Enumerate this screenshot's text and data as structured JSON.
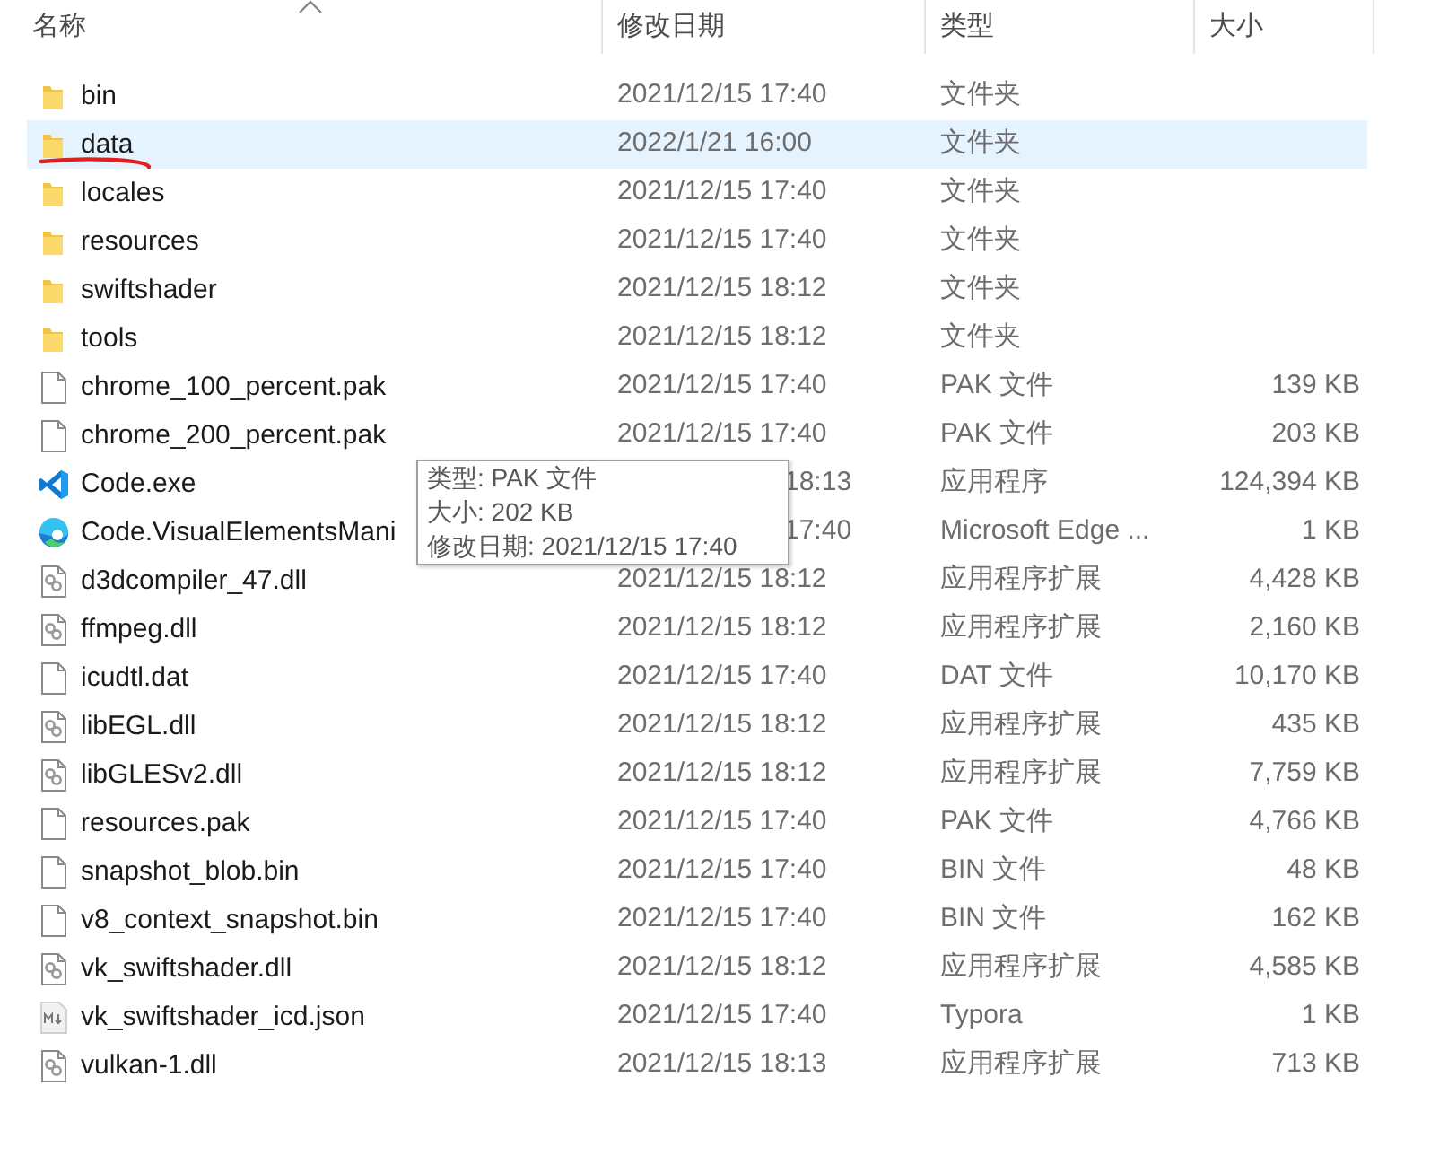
{
  "columns": [
    "名称",
    "修改日期",
    "类型",
    "大小"
  ],
  "rows": [
    {
      "kind": "folder",
      "name": "bin",
      "date": "2021/12/15 17:40",
      "type": "文件夹",
      "selected": false,
      "underlined": false
    },
    {
      "kind": "folder",
      "name": "data",
      "date": "2022/1/21 16:00",
      "type": "文件夹",
      "selected": true,
      "underlined": true
    },
    {
      "kind": "folder",
      "name": "locales",
      "date": "2021/12/15 17:40",
      "type": "文件夹",
      "selected": false,
      "underlined": false
    },
    {
      "kind": "folder",
      "name": "resources",
      "date": "2021/12/15 17:40",
      "type": "文件夹",
      "selected": false,
      "underlined": false
    },
    {
      "kind": "folder",
      "name": "swiftshader",
      "date": "2021/12/15 18:12",
      "type": "文件夹",
      "selected": false,
      "underlined": false
    },
    {
      "kind": "folder",
      "name": "tools",
      "date": "2021/12/15 18:12",
      "type": "文件夹",
      "selected": false,
      "underlined": false
    },
    {
      "kind": "file",
      "name": "chrome_100_percent.pak",
      "date": "2021/12/15 17:40",
      "type": "PAK 文件",
      "size": "139 KB",
      "selected": false,
      "underlined": false
    },
    {
      "kind": "file",
      "name": "chrome_200_percent.pak",
      "date": "2021/12/15 17:40",
      "type": "PAK 文件",
      "size": "203 KB",
      "selected": false,
      "underlined": false
    },
    {
      "kind": "vscode",
      "name": "Code.exe",
      "date": "18:13",
      "type": "应用程序",
      "size": "124,394 KB",
      "selected": false,
      "underlined": false
    },
    {
      "kind": "edge",
      "name": "Code.VisualElementsMani",
      "date": "17:40",
      "type": "Microsoft Edge ...",
      "size": "1 KB",
      "selected": false,
      "underlined": false
    },
    {
      "kind": "dll",
      "name": "d3dcompiler_47.dll",
      "date": "2021/12/15 18:12",
      "type": "应用程序扩展",
      "size": "4,428 KB",
      "selected": false,
      "underlined": false
    },
    {
      "kind": "dll",
      "name": "ffmpeg.dll",
      "date": "2021/12/15 18:12",
      "type": "应用程序扩展",
      "size": "2,160 KB",
      "selected": false,
      "underlined": false
    },
    {
      "kind": "file",
      "name": "icudtl.dat",
      "date": "2021/12/15 17:40",
      "type": "DAT 文件",
      "size": "10,170 KB",
      "selected": false,
      "underlined": false
    },
    {
      "kind": "dll",
      "name": "libEGL.dll",
      "date": "2021/12/15 18:12",
      "type": "应用程序扩展",
      "size": "435 KB",
      "selected": false,
      "underlined": false
    },
    {
      "kind": "dll",
      "name": "libGLESv2.dll",
      "date": "2021/12/15 18:12",
      "type": "应用程序扩展",
      "size": "7,759 KB",
      "selected": false,
      "underlined": false
    },
    {
      "kind": "file",
      "name": "resources.pak",
      "date": "2021/12/15 17:40",
      "type": "PAK 文件",
      "size": "4,766 KB",
      "selected": false,
      "underlined": false
    },
    {
      "kind": "file",
      "name": "snapshot_blob.bin",
      "date": "2021/12/15 17:40",
      "type": "BIN 文件",
      "size": "48 KB",
      "selected": false,
      "underlined": false
    },
    {
      "kind": "file",
      "name": "v8_context_snapshot.bin",
      "date": "2021/12/15 17:40",
      "type": "BIN 文件",
      "size": "162 KB",
      "selected": false,
      "underlined": false
    },
    {
      "kind": "dll",
      "name": "vk_swiftshader.dll",
      "date": "2021/12/15 18:12",
      "type": "应用程序扩展",
      "size": "4,585 KB",
      "selected": false,
      "underlined": false
    },
    {
      "kind": "markdown",
      "name": "vk_swiftshader_icd.json",
      "date": "2021/12/15 17:40",
      "type": "Typora",
      "size": "1 KB",
      "selected": false,
      "underlined": false
    },
    {
      "kind": "dll",
      "name": "vulkan-1.dll",
      "date": "2021/12/15 18:13",
      "type": "应用程序扩展",
      "size": "713 KB",
      "selected": false,
      "underlined": false
    }
  ],
  "tooltip": [
    "类型: PAK 文件",
    "大小: 202 KB",
    "修改日期: 2021/12/15 17:40"
  ]
}
